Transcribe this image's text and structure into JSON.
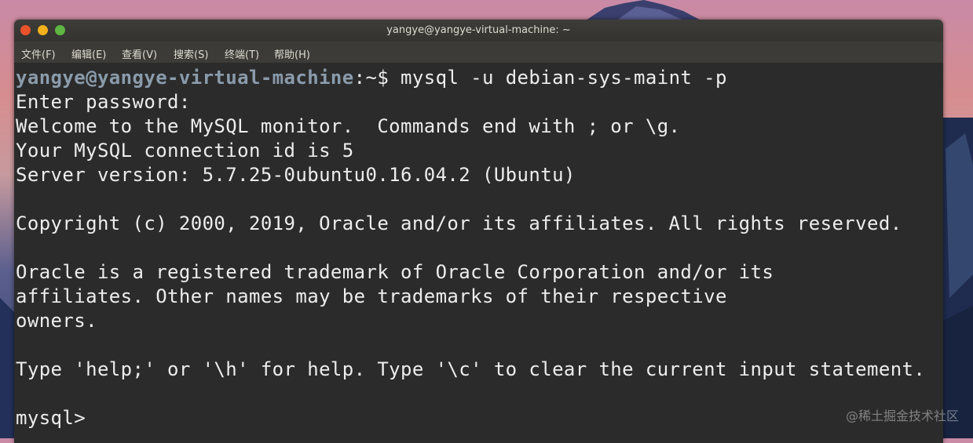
{
  "window": {
    "title": "yangye@yangye-virtual-machine: ~"
  },
  "menu": {
    "items": [
      "文件(F)",
      "编辑(E)",
      "查看(V)",
      "搜索(S)",
      "终端(T)",
      "帮助(H)"
    ]
  },
  "terminal": {
    "prompt_user": "yangye@yangye-virtual-machine",
    "prompt_path": ":~$ ",
    "command": "mysql -u debian-sys-maint -p",
    "lines": [
      "Enter password:",
      "Welcome to the MySQL monitor.  Commands end with ; or \\g.",
      "Your MySQL connection id is 5",
      "Server version: 5.7.25-0ubuntu0.16.04.2 (Ubuntu)",
      "",
      "Copyright (c) 2000, 2019, Oracle and/or its affiliates. All rights reserved.",
      "",
      "Oracle is a registered trademark of Oracle Corporation and/or its",
      "affiliates. Other names may be trademarks of their respective",
      "owners.",
      "",
      "Type 'help;' or '\\h' for help. Type '\\c' to clear the current input statement.",
      "",
      "mysql>"
    ]
  },
  "watermark": "@稀土掘金技术社区",
  "colors": {
    "terminal_bg": "#2b2b2b",
    "terminal_fg": "#ededed",
    "prompt_user": "#8a9bab",
    "close": "#e9532a",
    "minimize": "#f3b11c",
    "maximize": "#5eb542"
  }
}
